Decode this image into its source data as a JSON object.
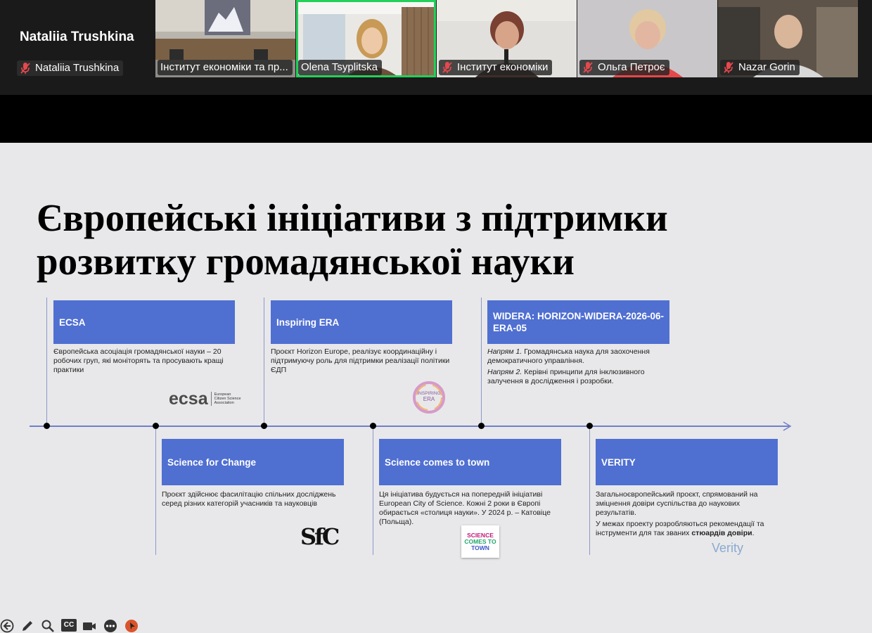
{
  "participants": {
    "self": {
      "display_name": "Nataliia Trushkina",
      "tag": "Nataliia Trushkina"
    },
    "tiles": [
      {
        "name": "Інститут економіки та пр...",
        "active": false
      },
      {
        "name": "Olena Tsyplitska",
        "active": true
      },
      {
        "name": "Інститут економіки",
        "active": false
      },
      {
        "name": "Ольга Петроє",
        "active": false
      },
      {
        "name": "Nazar Gorin",
        "active": false
      }
    ]
  },
  "slide": {
    "title_line1": "Європейські ініціативи з підтримки",
    "title_line2": "розвитку громадянської науки",
    "items": {
      "ecsa": {
        "title": "ECSA",
        "text": "Європейська асоціація громадянської науки – 20 робочих груп, які моніторять та просувають кращі практики"
      },
      "era": {
        "title": "Inspiring ERA",
        "text": "Проєкт Horizon Europe, реалізує координаційну і підтримуючу роль для підтримки реалізації політики ЄДП"
      },
      "widera": {
        "title": "WIDERA: HORIZON-WIDERA-2026-06-ERA-05",
        "dir1_label": "Напрям 1.",
        "dir1_text": " Громадянська наука для заохочення демократичного управління.",
        "dir2_label": "Напрям 2.",
        "dir2_text": " Керівні принципи для інклюзивного залучення в дослідження і розробки."
      },
      "sfc": {
        "title": "Science for Change",
        "text": "Проєкт здійснює фасилітацію спільних досліджень серед різних категорій учасників та науковців"
      },
      "sct": {
        "title": "Science comes to town",
        "text": "Ця ініціатива будується на попередній ініціативі European City of Science. Кожні 2 роки в Європі обирається «столиця науки». У 2024 р. – Катовіце (Польща)."
      },
      "verity": {
        "title": "VERITY",
        "text1": "Загальноєвропейський проєкт, спрямований на зміцнення довіри суспільства до наукових результатів.",
        "text2_a": "У межах проекту розробляються рекомендації та інструменти для так званих ",
        "text2_b": "стюардів довіри",
        "text2_c": "."
      }
    },
    "logos": {
      "ecsa_word": "ecsa",
      "ecsa_sub1": "European",
      "ecsa_sub2": "Citizen Science",
      "ecsa_sub3": "Association",
      "era_line1": "INSPIRING",
      "era_line2": "ERA",
      "sfc_mark": "SfC",
      "sct_line1": "SCIENCE",
      "sct_line2": "COMES TO",
      "sct_line3": "TOWN",
      "verity_word": "Verity"
    },
    "colors": {
      "box": "#4f6fd1",
      "timeline": "#6f80c9",
      "active_speaker": "#23d05a"
    }
  },
  "toolbar": {
    "icons": [
      "back-arrow-icon",
      "pen-icon",
      "zoom-icon",
      "captions-icon",
      "camera-icon",
      "more-icon",
      "pointer-icon"
    ],
    "cc_label": "CC"
  }
}
